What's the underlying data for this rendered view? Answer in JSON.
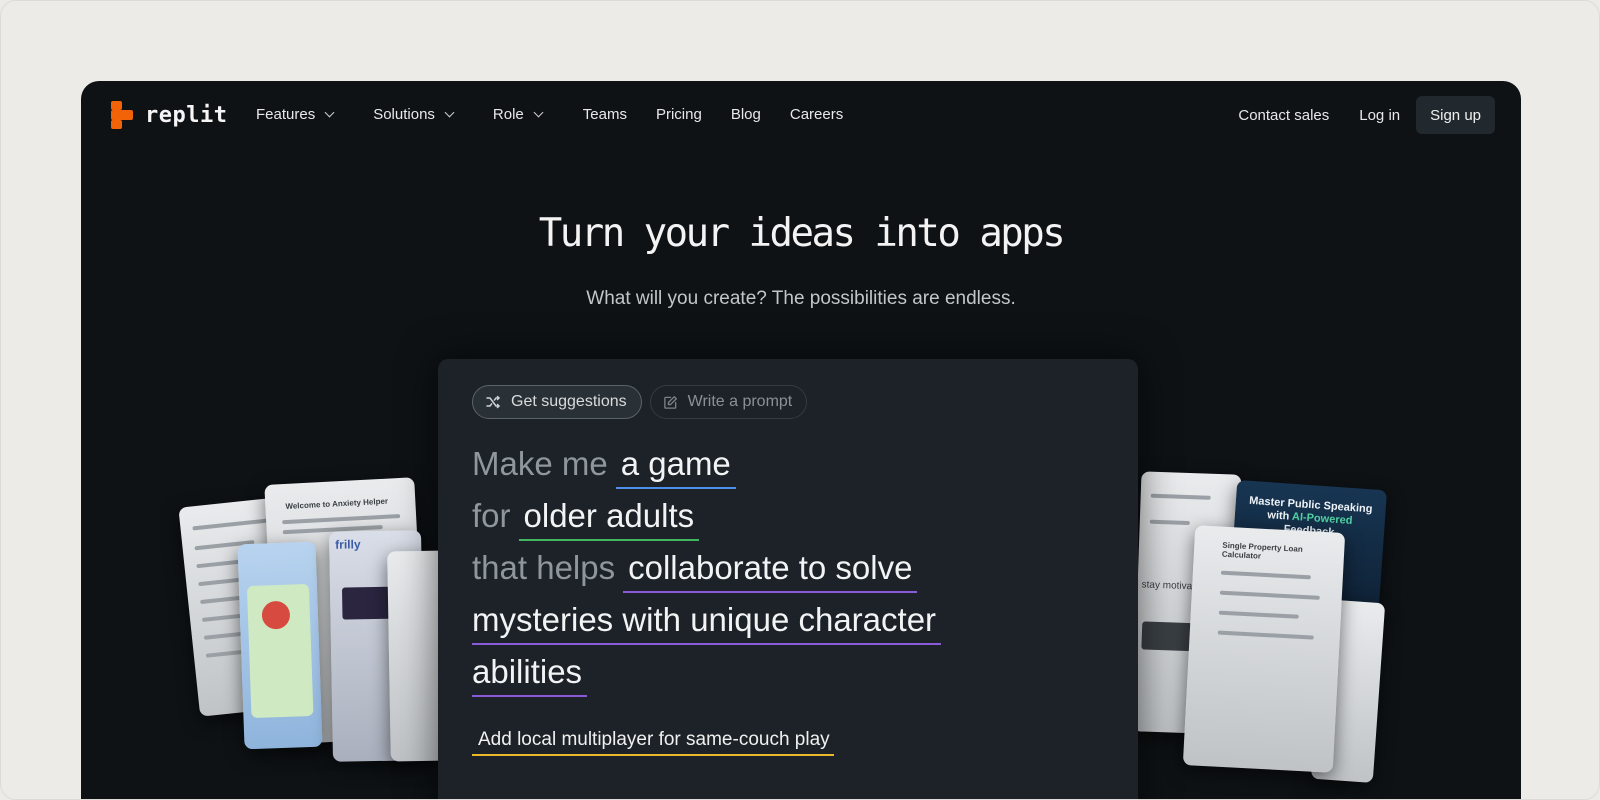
{
  "nav": {
    "logo_text": "replit",
    "brand_color": "#f26207",
    "items": [
      {
        "label": "Features",
        "dropdown": true
      },
      {
        "label": "Solutions",
        "dropdown": true
      },
      {
        "label": "Role",
        "dropdown": true
      },
      {
        "label": "Teams",
        "dropdown": false
      },
      {
        "label": "Pricing",
        "dropdown": false
      },
      {
        "label": "Blog",
        "dropdown": false
      },
      {
        "label": "Careers",
        "dropdown": false
      }
    ],
    "contact_label": "Contact sales",
    "login_label": "Log in",
    "signup_label": "Sign up"
  },
  "hero": {
    "title": "Turn your ideas into apps",
    "subtitle": "What will you create? The possibilities are endless."
  },
  "panel": {
    "tabs": [
      {
        "label": "Get suggestions",
        "icon": "shuffle-icon",
        "active": true
      },
      {
        "label": "Write a prompt",
        "icon": "edit-icon",
        "active": false
      }
    ],
    "prompt": {
      "prefix1": "Make me",
      "chip1": "a game",
      "prefix2": "for",
      "chip2": "older adults",
      "prefix3": "that helps",
      "chip3a": "collaborate to solve",
      "chip3b": "mysteries with unique character",
      "chip3c": "abilities"
    },
    "suggestion": "Add local multiplayer for same-couch play"
  },
  "background_cards": {
    "left_title": "Welcome to Anxiety Helper",
    "left_app": "frilly",
    "right_title": "Master Public Speaking with",
    "right_highlight": "AI-Powered",
    "right_tail": "Feedback",
    "right_card2": "Single Property Loan Calculator",
    "right_card3": "stay motivated"
  }
}
